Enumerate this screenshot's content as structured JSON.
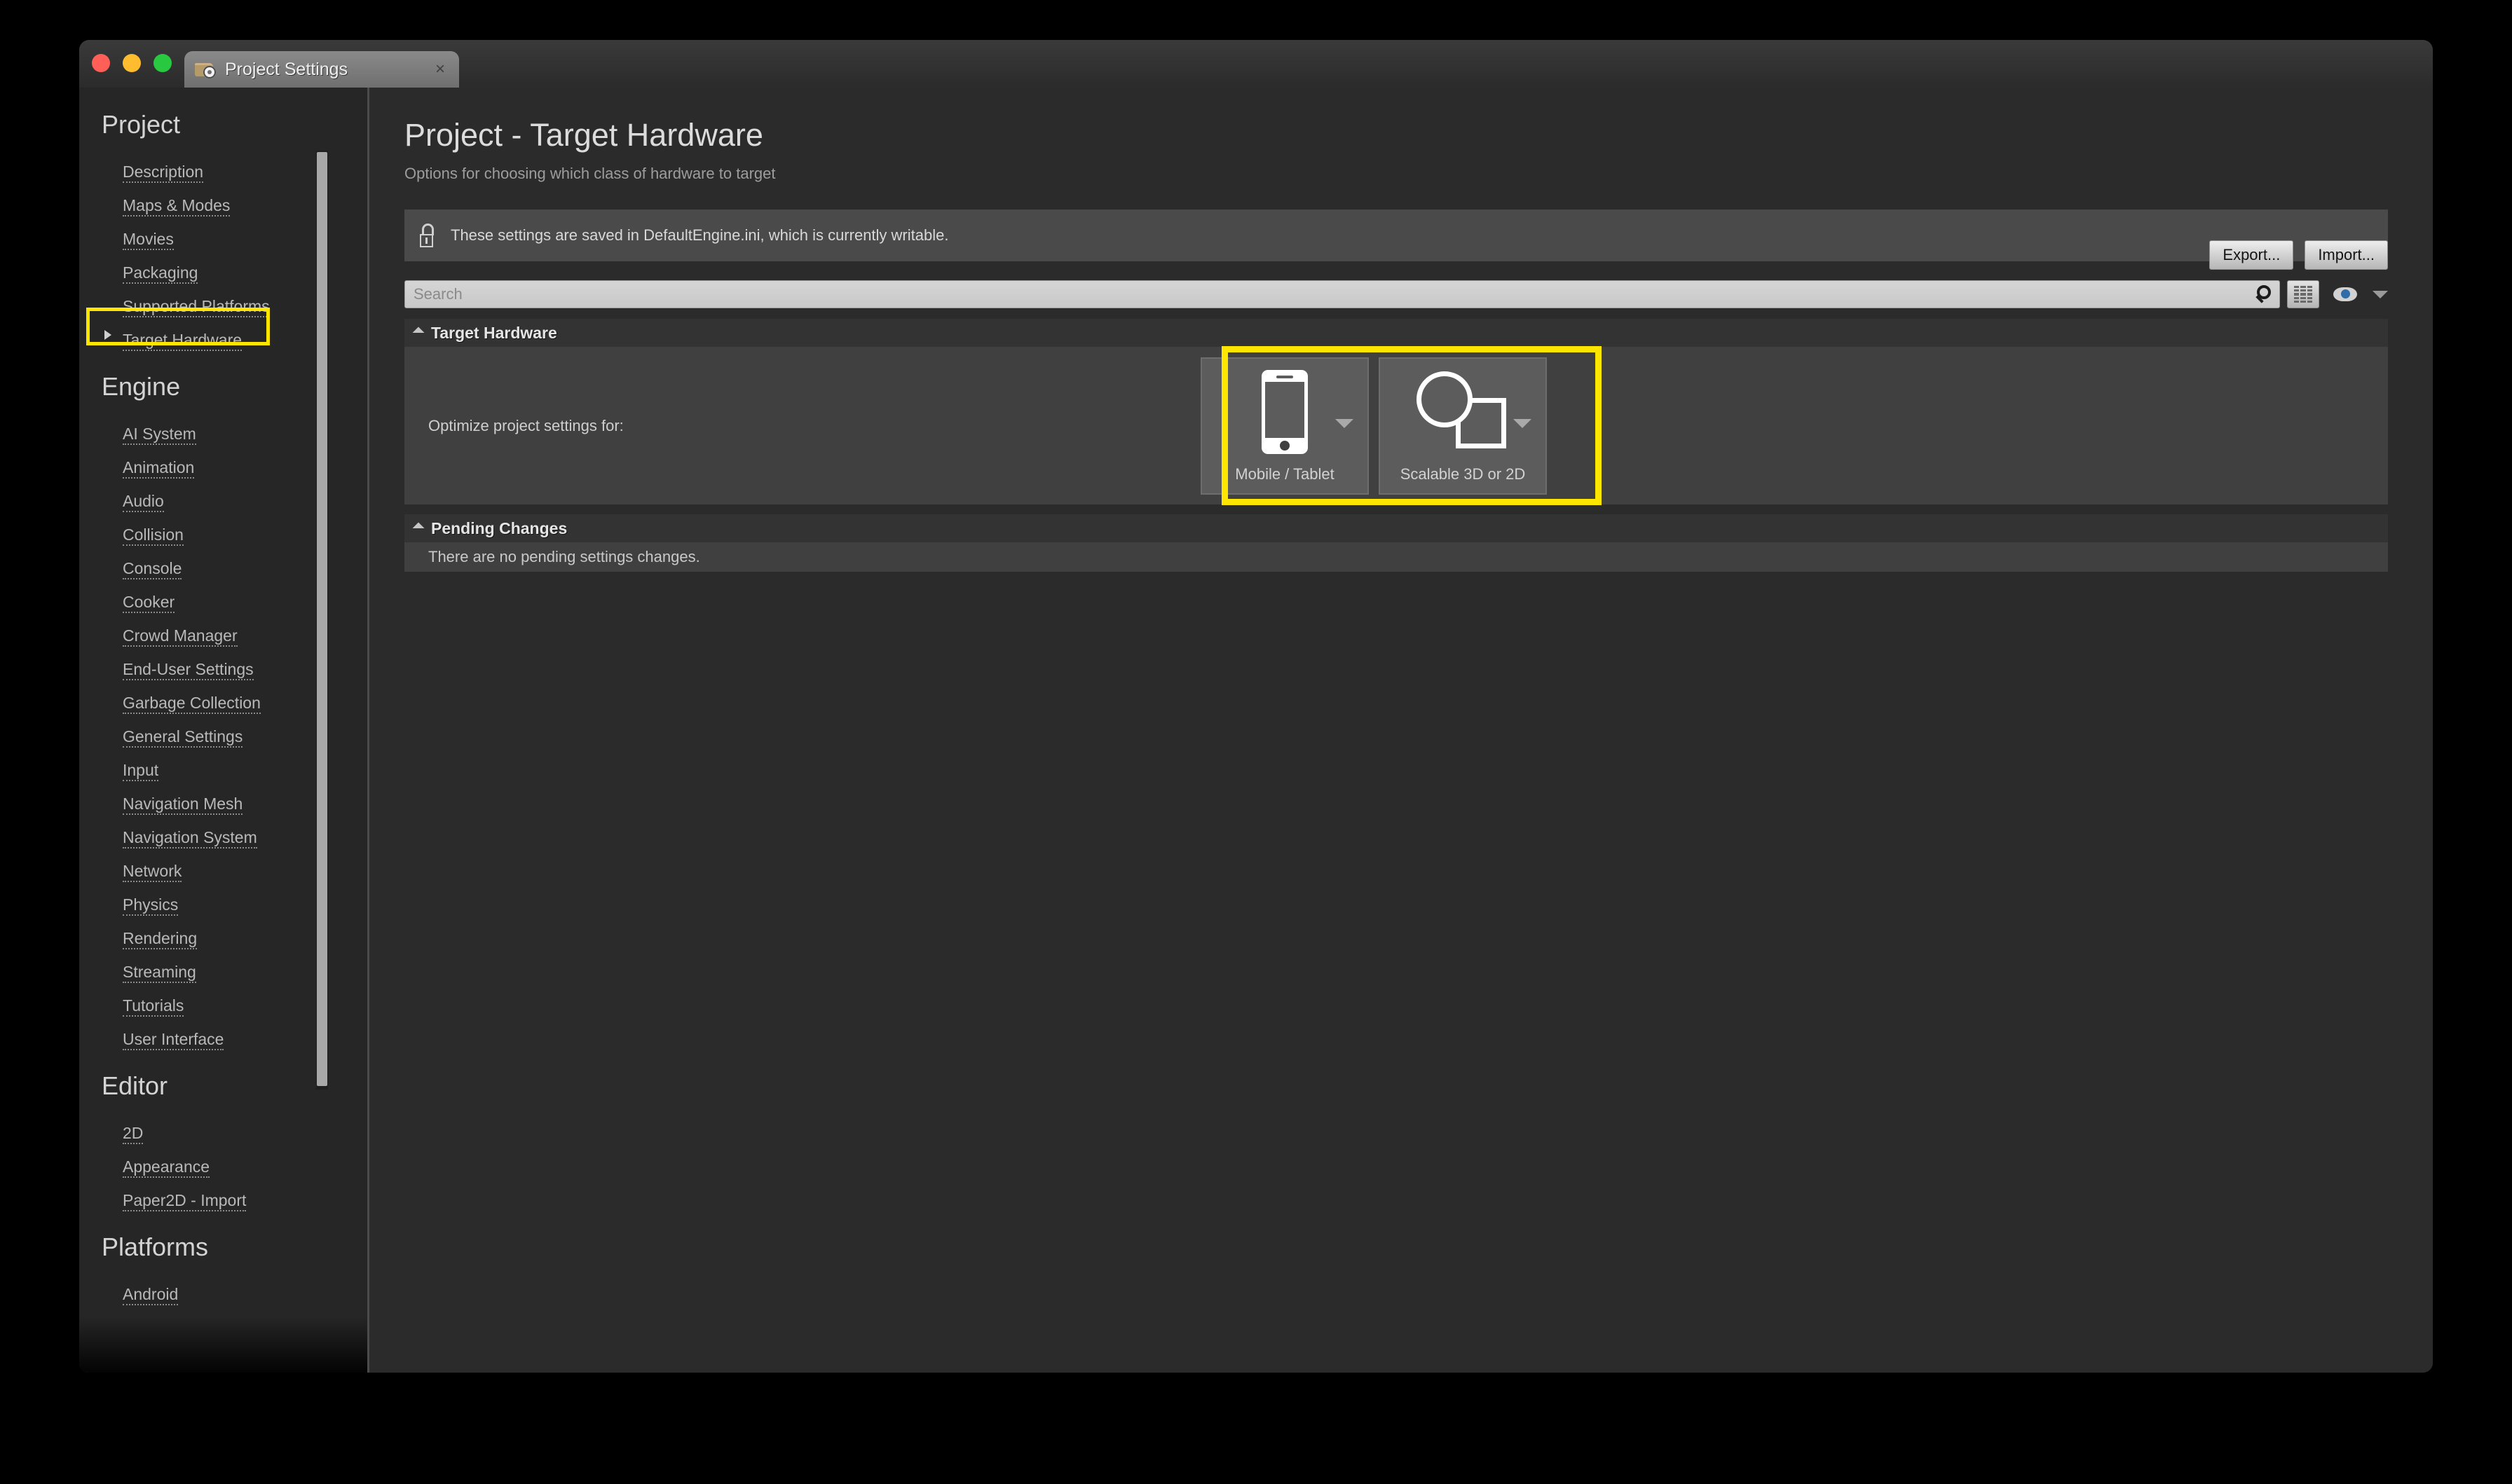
{
  "window": {
    "traffic_lights": [
      "close",
      "minimize",
      "maximize"
    ],
    "tab": {
      "label": "Project Settings",
      "icon": "folder-gear-icon",
      "close": "×"
    }
  },
  "sidebar": {
    "sections": [
      {
        "title": "Project",
        "items": [
          {
            "label": "Description",
            "selected": false
          },
          {
            "label": "Maps & Modes",
            "selected": false
          },
          {
            "label": "Movies",
            "selected": false
          },
          {
            "label": "Packaging",
            "selected": false
          },
          {
            "label": "Supported Platforms",
            "selected": false
          },
          {
            "label": "Target Hardware",
            "selected": true
          }
        ]
      },
      {
        "title": "Engine",
        "items": [
          {
            "label": "AI System",
            "selected": false
          },
          {
            "label": "Animation",
            "selected": false
          },
          {
            "label": "Audio",
            "selected": false
          },
          {
            "label": "Collision",
            "selected": false
          },
          {
            "label": "Console",
            "selected": false
          },
          {
            "label": "Cooker",
            "selected": false
          },
          {
            "label": "Crowd Manager",
            "selected": false
          },
          {
            "label": "End-User Settings",
            "selected": false
          },
          {
            "label": "Garbage Collection",
            "selected": false
          },
          {
            "label": "General Settings",
            "selected": false
          },
          {
            "label": "Input",
            "selected": false
          },
          {
            "label": "Navigation Mesh",
            "selected": false
          },
          {
            "label": "Navigation System",
            "selected": false
          },
          {
            "label": "Network",
            "selected": false
          },
          {
            "label": "Physics",
            "selected": false
          },
          {
            "label": "Rendering",
            "selected": false
          },
          {
            "label": "Streaming",
            "selected": false
          },
          {
            "label": "Tutorials",
            "selected": false
          },
          {
            "label": "User Interface",
            "selected": false
          }
        ]
      },
      {
        "title": "Editor",
        "items": [
          {
            "label": "2D",
            "selected": false
          },
          {
            "label": "Appearance",
            "selected": false
          },
          {
            "label": "Paper2D - Import",
            "selected": false
          }
        ]
      },
      {
        "title": "Platforms",
        "items": [
          {
            "label": "Android",
            "selected": false
          }
        ]
      }
    ]
  },
  "main": {
    "title": "Project - Target Hardware",
    "subtitle": "Options for choosing which class of hardware to target",
    "export_label": "Export...",
    "import_label": "Import...",
    "notice": {
      "icon": "unlocked-padlock-icon",
      "text": "These settings are saved in DefaultEngine.ini, which is currently writable."
    },
    "search": {
      "placeholder": "Search",
      "value": "",
      "magnifier_icon": "search-icon",
      "listview_icon": "list-view-icon",
      "visibility_icon": "eye-icon",
      "visibility_caret": "chevron-down-icon"
    },
    "target_hardware": {
      "header": "Target Hardware",
      "property_label": "Optimize project settings for:",
      "options": [
        {
          "label": "Mobile / Tablet",
          "icon": "mobile-phone-icon",
          "caret": "chevron-down-icon"
        },
        {
          "label": "Scalable 3D or 2D",
          "icon": "circle-square-icon",
          "caret": "chevron-down-icon"
        }
      ]
    },
    "pending_changes": {
      "header": "Pending Changes",
      "text": "There are no pending settings changes."
    }
  },
  "annotations": {
    "highlight_color": "#ffe600",
    "targets": [
      "sidebar-item-target-hardware",
      "target-hardware-options"
    ]
  }
}
